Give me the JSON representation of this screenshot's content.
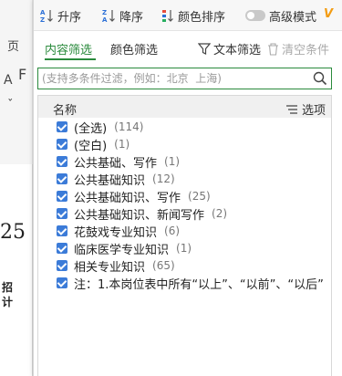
{
  "background": {
    "fragments": [
      "页",
      "F",
      "A",
      "ˇ",
      "F",
      "25",
      "招",
      "计"
    ]
  },
  "toolbar": {
    "sort_asc": "升序",
    "sort_desc": "降序",
    "color_sort": "颜色排序",
    "advanced_mode": "高级模式",
    "advanced_mode_on": false
  },
  "tabs": {
    "content_filter": "内容筛选",
    "color_filter": "颜色筛选",
    "text_filter": "文本筛选",
    "clear_conditions": "清空条件"
  },
  "search": {
    "placeholder": "(支持多条件过滤，例如：北京  上海)"
  },
  "list": {
    "header": "名称",
    "options_label": "选项",
    "items": [
      {
        "label": "(全选)",
        "count": "(114)",
        "checked": true
      },
      {
        "label": "(空白)",
        "count": "(1)",
        "checked": true
      },
      {
        "label": "公共基础、写作",
        "count": "(1)",
        "checked": true
      },
      {
        "label": "公共基础知识",
        "count": "(12)",
        "checked": true
      },
      {
        "label": "公共基础知识、写作",
        "count": "(25)",
        "checked": true
      },
      {
        "label": "公共基础知识、新闻写作",
        "count": "(2)",
        "checked": true
      },
      {
        "label": "花鼓戏专业知识",
        "count": "(6)",
        "checked": true
      },
      {
        "label": "临床医学专业知识",
        "count": "(1)",
        "checked": true
      },
      {
        "label": "相关专业知识",
        "count": "(65)",
        "checked": true
      },
      {
        "label": "注：1.本岗位表中所有“以上”、“以前”、“以后”",
        "count": "",
        "checked": true
      }
    ]
  },
  "colors": {
    "accent_green": "#2a8a3c",
    "checkbox_blue": "#3b7bd8",
    "sort_asc_blue": "#2b6fd6",
    "sort_desc_blue": "#2b6fd6",
    "advanced_v": "#f39c12"
  }
}
